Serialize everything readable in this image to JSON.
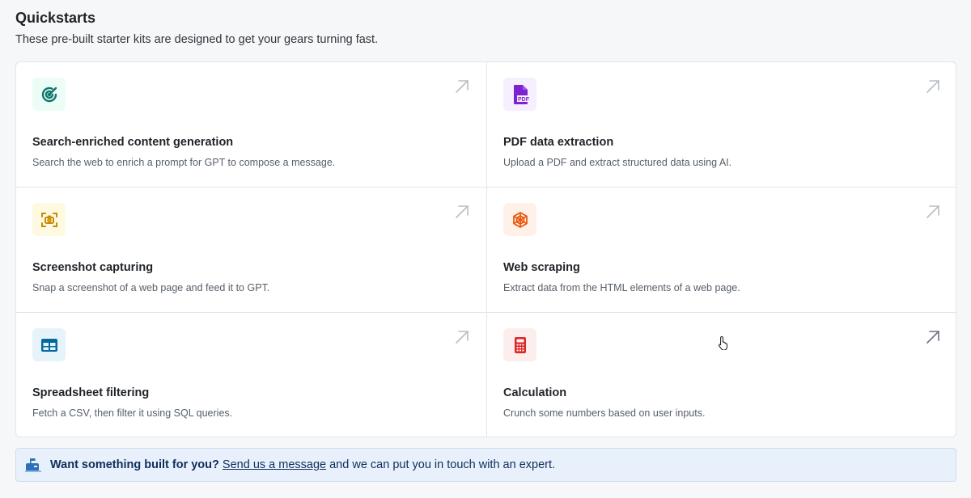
{
  "header": {
    "title": "Quickstarts",
    "subtitle": "These pre-built starter kits are designed to get your gears turning fast."
  },
  "cards": [
    {
      "title": "Search-enriched content generation",
      "description": "Search the web to enrich a prompt for GPT to compose a message.",
      "icon": "search-target-icon"
    },
    {
      "title": "PDF data extraction",
      "description": "Upload a PDF and extract structured data using AI.",
      "icon": "pdf-file-icon",
      "icon_text": "PDF"
    },
    {
      "title": "Screenshot capturing",
      "description": "Snap a screenshot of a web page and feed it to GPT.",
      "icon": "screenshot-camera-icon"
    },
    {
      "title": "Web scraping",
      "description": "Extract data from the HTML elements of a web page.",
      "icon": "spider-web-icon"
    },
    {
      "title": "Spreadsheet filtering",
      "description": "Fetch a CSV, then filter it using SQL queries.",
      "icon": "table-icon"
    },
    {
      "title": "Calculation",
      "description": "Crunch some numbers based on user inputs.",
      "icon": "calculator-icon"
    }
  ],
  "banner": {
    "icon": "mailbox-icon",
    "strong": "Want something built for you?",
    "link": "Send us a message",
    "rest": " and we can put you in touch with an expert."
  },
  "colors": {
    "teal": "#0f766e",
    "purple": "#7e22ce",
    "yellow": "#ca8a04",
    "orange": "#ea580c",
    "blue": "#0369a1",
    "red": "#dc2626",
    "arrow": "#b8bec6"
  }
}
